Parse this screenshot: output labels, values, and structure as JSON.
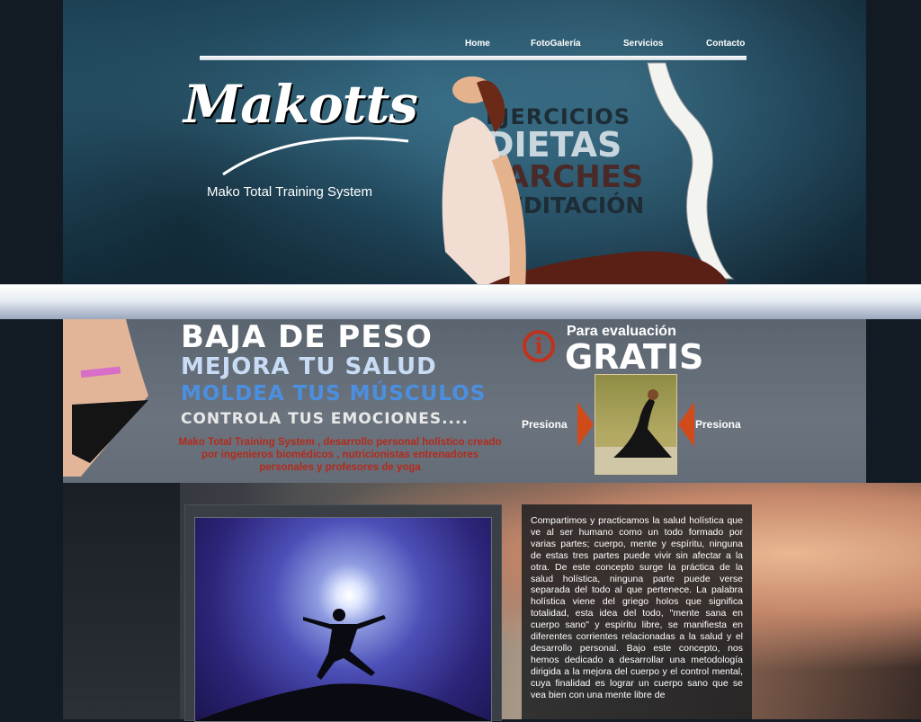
{
  "nav": {
    "items": [
      "Home",
      "FotoGalería",
      "Servicios",
      "Contacto"
    ]
  },
  "brand": {
    "logo": "Makotts",
    "tagline": "Mako Total Training System"
  },
  "hero_words": [
    "EJERCICIOS",
    "DIETAS",
    "PARCHES",
    "MEDITACIÓN"
  ],
  "promo": {
    "line1": "BAJA DE PESO",
    "line2": "MEJORA TU SALUD",
    "line3": "MOLDEA TUS MÚSCULOS",
    "line4": "CONTROLA TUS EMOCIONES....",
    "description": "Mako Total Training System , desarrollo personal holístico creado por ingenieros biomédicos , nutricionistas entrenadores personales y profesores de yoga",
    "eval_label": "Para evaluación",
    "gratis": "GRATIS",
    "press_left": "Presiona",
    "press_right": "Presiona",
    "info_glyph": "i"
  },
  "main": {
    "body": "Compartimos y practicamos la salud holística que ve al ser humano como un todo formado por varias partes; cuerpo, mente y espíritu, ninguna de estas tres partes puede vivir sin afectar a la otra. De este concepto surge la práctica de la salud holística, ninguna parte puede verse separada del todo al que pertenece. La palabra holística viene del griego holos que significa totalidad, esta idea del todo, \"mente sana en cuerpo sano\" y espíritu libre, se manifiesta en diferentes corrientes relacionadas a la salud y el desarrollo personal. Bajo este concepto, nos hemos dedicado a desarrollar una metodología dirigida a la mejora del cuerpo y el control mental, cuya finalidad es lograr un cuerpo sano que se vea bien con una mente libre de"
  },
  "colors": {
    "accent_red": "#c0321e",
    "arrow_orange": "#d04a1a",
    "blue_text": "#4b8fe0"
  }
}
